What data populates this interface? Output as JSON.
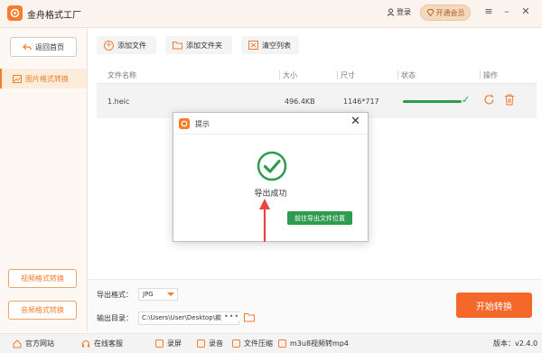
{
  "app": {
    "title": "金舟格式工厂",
    "login": "登录",
    "vip": "开通会员"
  },
  "sidebar": {
    "home": "返回首页",
    "active_item": "图片格式转换",
    "bottom_buttons": [
      "视频格式转换",
      "音频格式转换"
    ]
  },
  "toolbar": {
    "add_file": "添加文件",
    "add_folder": "添加文件夹",
    "clear_list": "清空列表"
  },
  "table": {
    "headers": [
      "文件名称",
      "大小",
      "尺寸",
      "状态",
      "操作"
    ],
    "rows": [
      {
        "name": "1.heic",
        "size": "496.4KB",
        "dims": "1146*717",
        "progress": 1.0
      }
    ]
  },
  "output": {
    "format_label": "导出格式：",
    "format_value": "JPG",
    "dir_label": "输出目录：",
    "dir_value": "C:\\Users\\User\\Desktop\\款"
  },
  "start_button": "开始转换",
  "statusbar": {
    "items": [
      "官方网站",
      "在线客服",
      "录屏",
      "录音",
      "文件压缩",
      "m3u8视频转mp4"
    ],
    "version": "版本：v2.4.0"
  },
  "dialog": {
    "title": "提示",
    "message": "导出成功",
    "button": "前往导出文件位置"
  },
  "colors": {
    "accent": "#f57c2b",
    "success": "#2e9b4e",
    "start": "#f4692a"
  }
}
